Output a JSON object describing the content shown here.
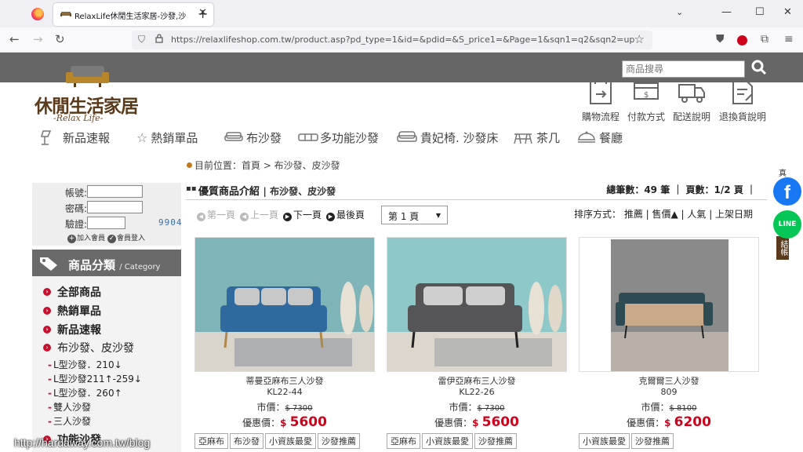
{
  "browser": {
    "tab_title": "RelaxLife休閒生活家居-沙發,沙",
    "tab_close": "✕",
    "new_tab": "+",
    "tab_list": "⌄",
    "url": "https://relaxlifeshop.com.tw/product.asp?pd_type=1&id=&pdid=&S_price1=&Page=1&sqn1=q2&sqn2=up",
    "window_controls": {
      "minimize": "—",
      "maximize": "☐",
      "close": "✕"
    }
  },
  "site": {
    "search_placeholder": "商品搜尋",
    "logo_title": "休閒生活家居",
    "logo_subtitle": "-Relax Life-",
    "services": [
      {
        "label": "購物流程",
        "icon": "shopping-flow-icon"
      },
      {
        "label": "付款方式",
        "icon": "payment-icon"
      },
      {
        "label": "配送說明",
        "icon": "delivery-icon"
      },
      {
        "label": "退換貨說明",
        "icon": "return-icon"
      }
    ],
    "nav": [
      {
        "label": "新品速報",
        "icon": "lamp-icon"
      },
      {
        "label": "熱銷單品",
        "icon": "star-icon"
      },
      {
        "label": "布沙發",
        "icon": "sofa-icon"
      },
      {
        "label": "多功能沙發",
        "icon": "sofa-bed-icon"
      },
      {
        "label": "貴妃椅. 沙發床",
        "icon": "chaise-icon"
      },
      {
        "label": "茶几",
        "icon": "table-icon"
      },
      {
        "label": "餐廳",
        "icon": "dining-icon"
      }
    ],
    "breadcrumb": "目前位置：首頁 > 布沙發、皮沙發"
  },
  "login": {
    "account_label": "帳號:",
    "password_label": "密碼:",
    "captcha_label": "驗證:",
    "captcha_code": "9904",
    "join_label": "加入會員",
    "login_label": "會員登入"
  },
  "categories": {
    "header": "商品分類",
    "header_en": "/ Category",
    "items": [
      "全部商品",
      "熱銷單品",
      "新品速報",
      "布沙發、皮沙發"
    ],
    "sub_items": [
      "L型沙發．210↓",
      "L型沙發211↑-259↓",
      "L型沙發．260↑",
      "雙人沙發",
      "三人沙發"
    ],
    "next_item": "功能沙發"
  },
  "listing": {
    "title": "優質商品介紹",
    "subtitle": "| 布沙發、皮沙發",
    "total": "總筆數：49 筆 ｜ 頁數：1/2 頁 ｜",
    "pager": {
      "first": "第一頁",
      "prev": "上一頁",
      "next": "下一頁",
      "last": "最後頁",
      "current": "第 1 頁"
    },
    "sort": "排序方式： 推薦 | 售價▲ | 人氣 | 上架日期"
  },
  "products": [
    {
      "name": "蒂曼亞麻布三人沙發",
      "code": "KL22-44",
      "list_label": "市價：",
      "list_price": "$ 7300",
      "sale_label": "優惠價：",
      "sale_currency": "$ ",
      "sale_price": "5600",
      "tags": [
        "亞麻布",
        "布沙發",
        "小資族最愛",
        "沙發推薦"
      ],
      "color": "#2f6a9e"
    },
    {
      "name": "雷伊亞麻布三人沙發",
      "code": "KL22-26",
      "list_label": "市價：",
      "list_price": "$ 7300",
      "sale_label": "優惠價：",
      "sale_currency": "$ ",
      "sale_price": "5600",
      "tags": [
        "亞麻布",
        "小資族最愛",
        "沙發推薦"
      ],
      "color": "#555558"
    },
    {
      "name": "克爾爾三人沙發",
      "code": "809",
      "list_label": "市價：",
      "list_price": "$ 8100",
      "sale_label": "優惠價：",
      "sale_currency": "$ ",
      "sale_price": "6200",
      "tags": [
        "小資族最愛",
        "沙發推薦"
      ],
      "color": "#c9a98a"
    }
  ],
  "social": {
    "facebook": "f",
    "line": "LINE",
    "side_tab": "結帳",
    "side_top": "真"
  },
  "watermark": "http://hardaway.com.tw/blog",
  "colors": {
    "accent_red": "#d0021b",
    "topbar": "#666666",
    "brand_brown": "#5a3a1a"
  }
}
